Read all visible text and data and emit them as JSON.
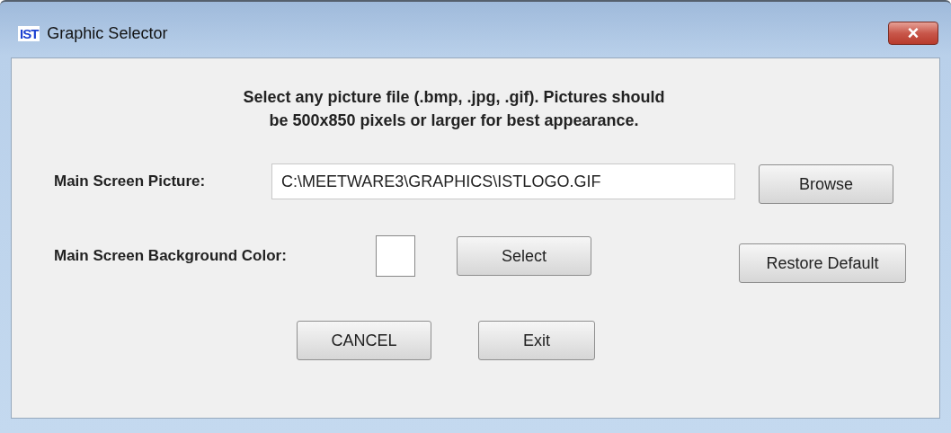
{
  "window": {
    "logo": "IST",
    "title": "Graphic Selector",
    "close": "×"
  },
  "instructions": [
    "Select any picture file (.bmp, .jpg, .gif). Pictures should",
    "be 500x850 pixels or larger for best appearance."
  ],
  "picture": {
    "label": "Main Screen Picture:",
    "value": "C:\\MEETWARE3\\GRAPHICS\\ISTLOGO.GIF",
    "button": "Browse"
  },
  "background": {
    "label": "Main Screen Background Color:",
    "color": "#ffffff",
    "button": "Select",
    "restore": "Restore Default"
  },
  "buttons": [
    "CANCEL",
    "Exit"
  ]
}
